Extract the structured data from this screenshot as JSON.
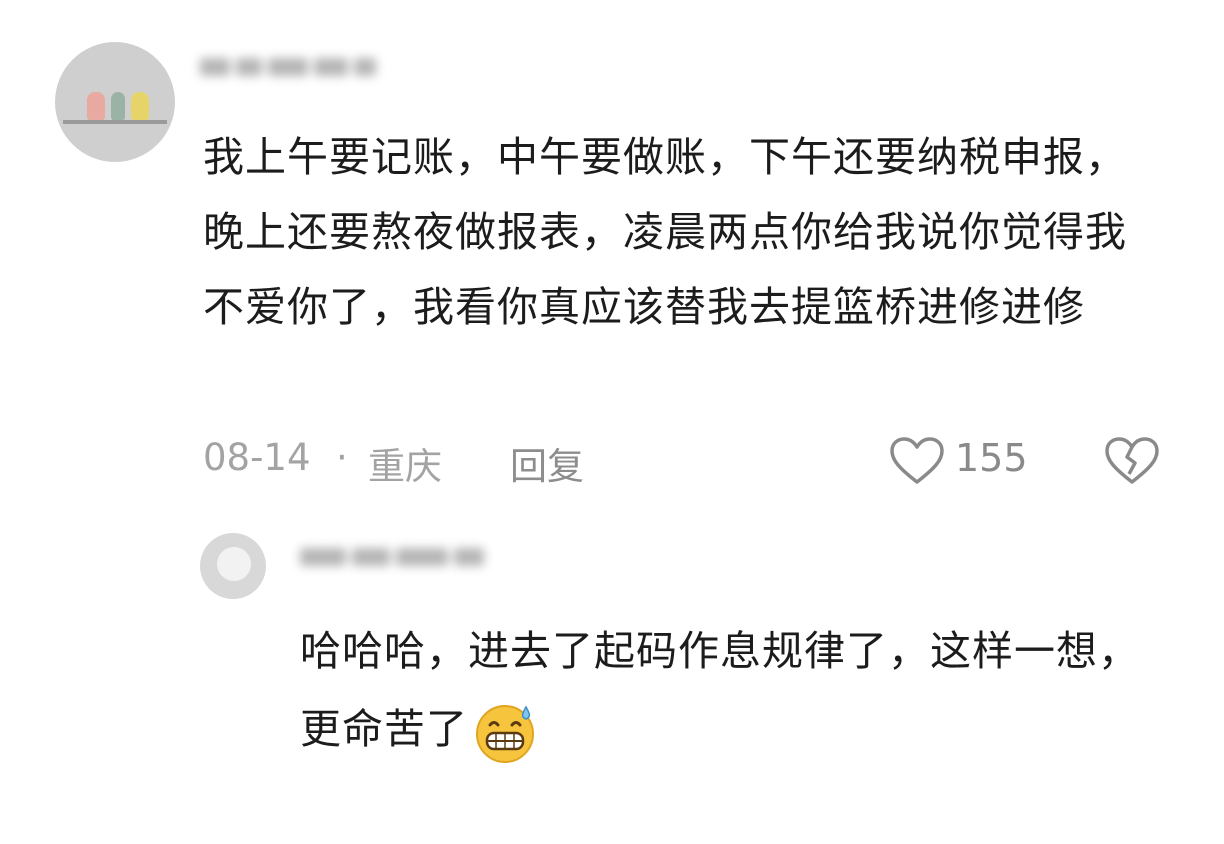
{
  "comment": {
    "text": "我上午要记账，中午要做账，下午还要纳税申报，晚上还要熬夜做报表，凌晨两点你给我说你觉得我不爱你了，我看你真应该替我去提篮桥进修进修",
    "date": "08-14",
    "separator": "·",
    "location": "重庆",
    "reply_label": "回复",
    "like_count": "155",
    "like_icon": "heart-outline-icon",
    "dislike_icon": "broken-heart-icon"
  },
  "reply": {
    "text": "哈哈哈，进去了起码作息规律了，这样一想，更命苦了",
    "emoji": "grinning-sweat-emoji"
  },
  "colors": {
    "text": "#1c1c1c",
    "meta": "#a3a3a3",
    "icon": "#8a8a8a",
    "background": "#ffffff"
  }
}
